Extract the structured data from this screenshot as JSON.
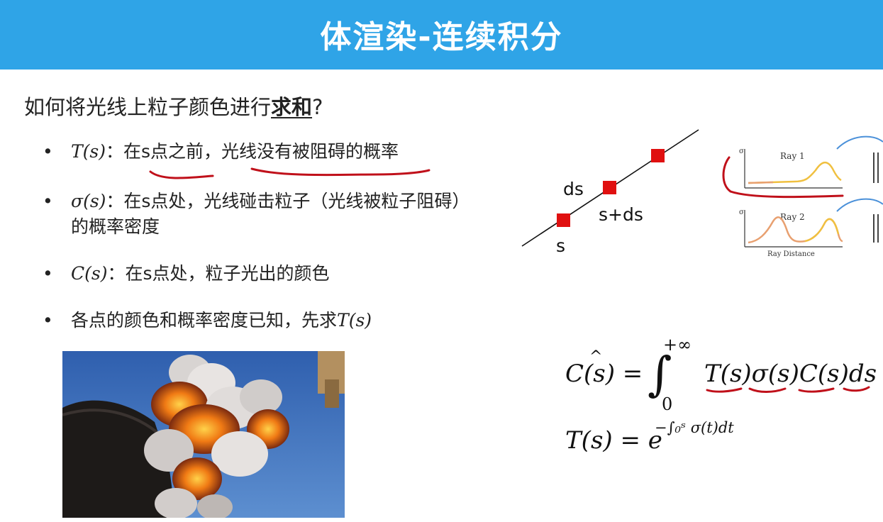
{
  "slide": {
    "title": "体渲染-连续积分",
    "question_pre": "如何将光线上粒子颜色进行",
    "question_emph": "求和",
    "question_post": "?"
  },
  "bullets": [
    {
      "symbol": "•",
      "math": "T(s)",
      "text": "：在s点之前，光线没有被阻碍的概率"
    },
    {
      "symbol": "•",
      "math": "σ(s)",
      "text": "：在s点处，光线碰击粒子（光线被粒子阻碍）的概率密度"
    },
    {
      "symbol": "•",
      "math": "C(s)",
      "text": "：在s点处，粒子光出的颜色"
    },
    {
      "symbol": "•",
      "text": "各点的颜色和概率密度已知，先求",
      "math_suffix": "T(s)"
    }
  ],
  "diagram": {
    "label_ds": "ds",
    "label_s_plus_ds": "s+ds",
    "label_s": "s"
  },
  "plots": {
    "ray1_title": "Ray 1",
    "ray2_title": "Ray 2",
    "y_axis_label": "σ",
    "x_axis_label": "Ray Distance"
  },
  "formulas": {
    "integral_lhs": "C(s) =",
    "integral_upper": "+∞",
    "integral_lower": "0",
    "integrand": "T(s)σ(s)C(s)ds",
    "transmittance_lhs": "T(s) = e",
    "transmittance_exp": "−∫₀ˢ σ(t)dt"
  },
  "colors": {
    "title_bar": "#2fa4e7",
    "marker": "#e01010",
    "annotation": "#c0101a",
    "plot_curve": "#f0c040",
    "arc": "#4a90d9"
  }
}
